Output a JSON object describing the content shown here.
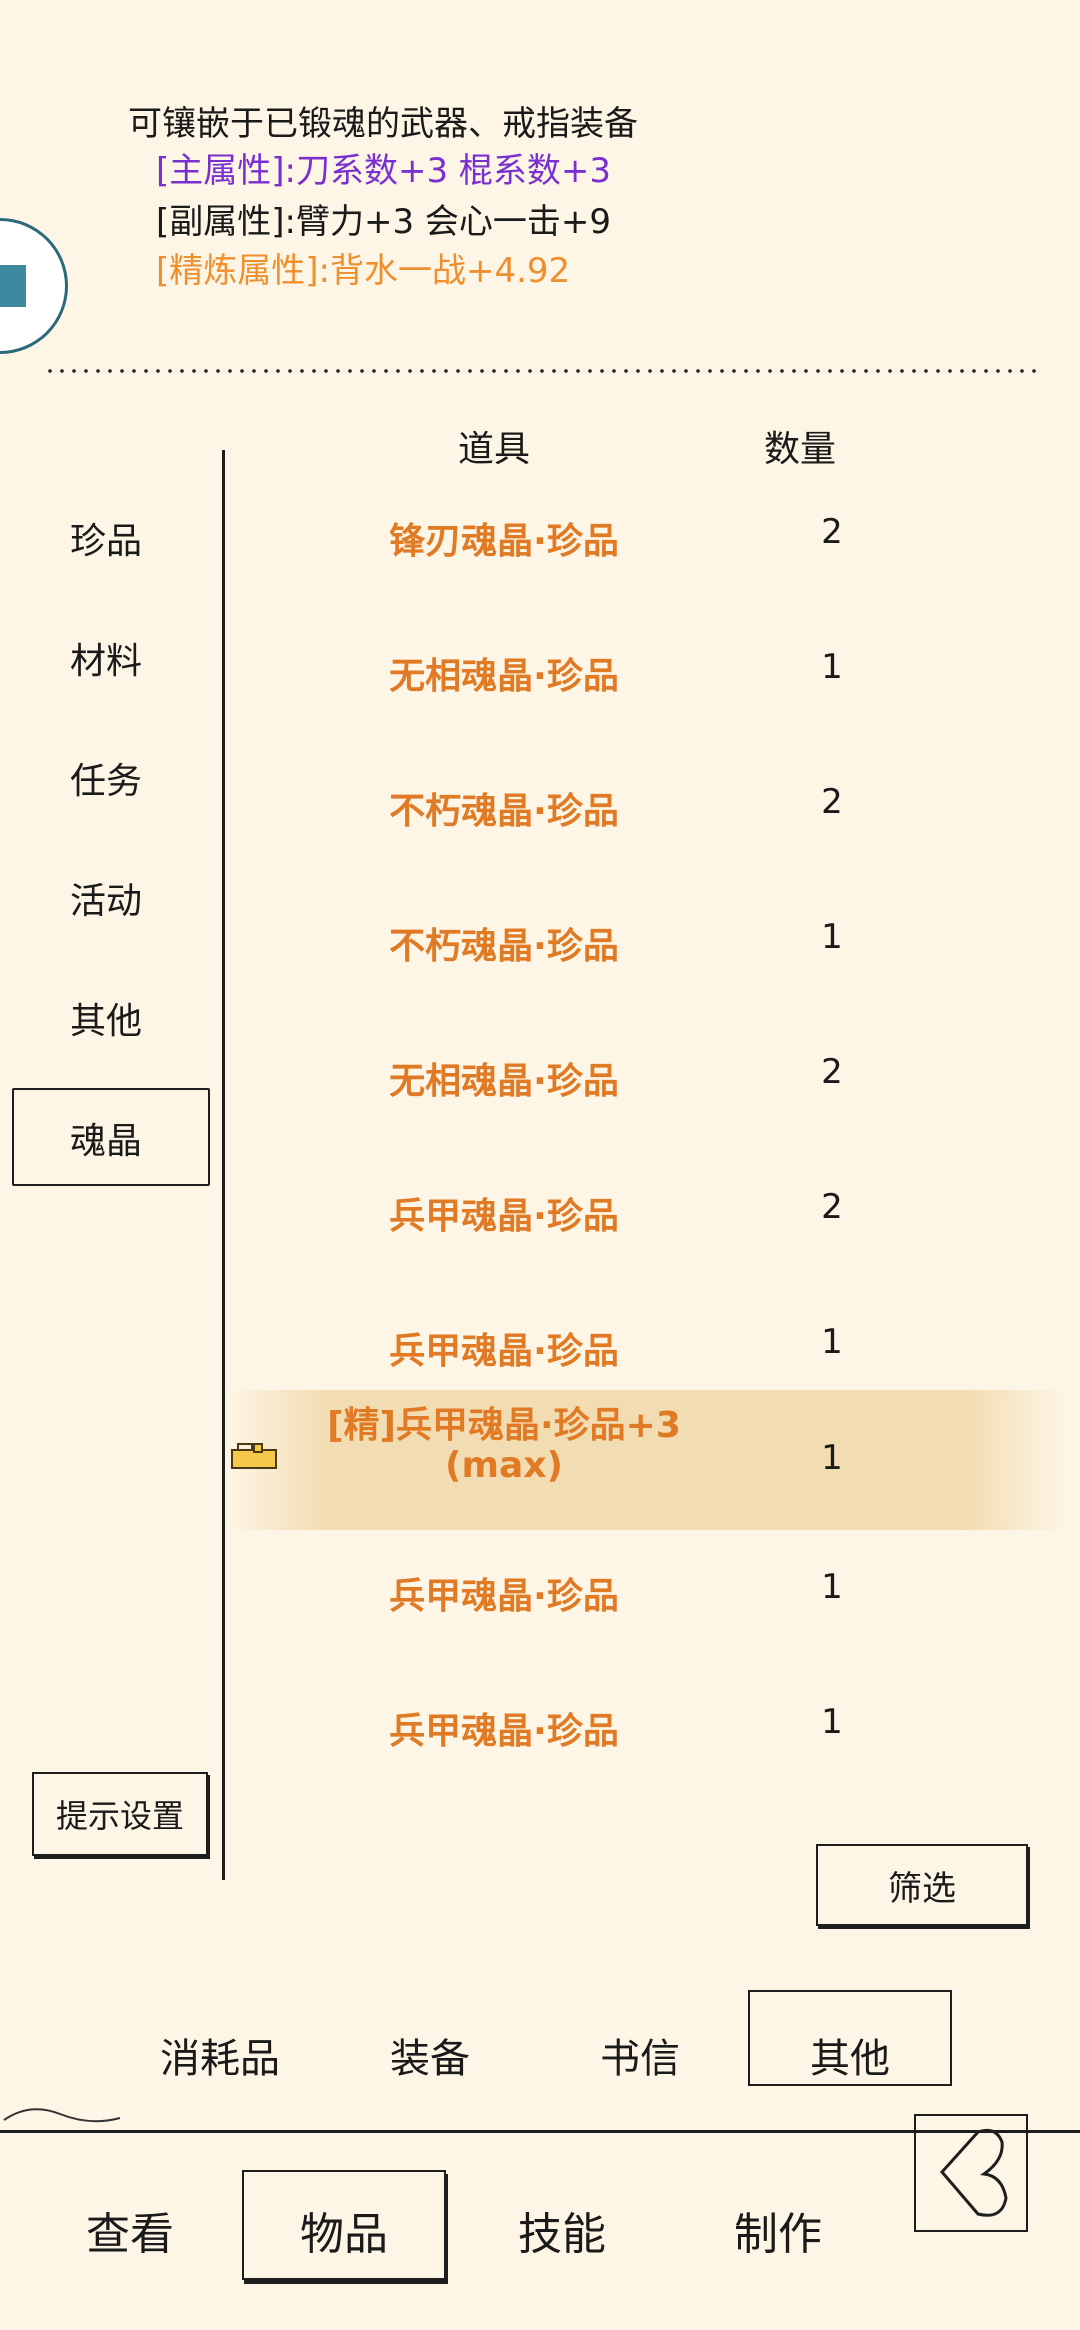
{
  "item_detail": {
    "description": "可镶嵌于已锻魂的武器、戒指装备",
    "main_attr": "[主属性]:刀系数+3 棍系数+3",
    "sub_attr": "[副属性]:臂力+3 会心一击+9",
    "refine_attr": "[精炼属性]:背水一战+4.92"
  },
  "sidebar": {
    "categories": [
      "珍品",
      "材料",
      "任务",
      "活动",
      "其他",
      "魂晶"
    ],
    "selected": "魂晶",
    "hint_button": "提示设置"
  },
  "table": {
    "headers": [
      "道具",
      "数量"
    ],
    "rows": [
      {
        "name": "锋刃魂晶·珍品",
        "qty": "2"
      },
      {
        "name": "无相魂晶·珍品",
        "qty": "1"
      },
      {
        "name": "不朽魂晶·珍品",
        "qty": "2"
      },
      {
        "name": "不朽魂晶·珍品",
        "qty": "1"
      },
      {
        "name": "无相魂晶·珍品",
        "qty": "2"
      },
      {
        "name": "兵甲魂晶·珍品",
        "qty": "2"
      },
      {
        "name": "兵甲魂晶·珍品",
        "qty": "1"
      },
      {
        "name": "[精]兵甲魂晶·珍品+3\n(max)",
        "qty": "1",
        "locked": true,
        "selected": true
      },
      {
        "name": "兵甲魂晶·珍品",
        "qty": "1"
      },
      {
        "name": "兵甲魂晶·珍品",
        "qty": "1"
      }
    ],
    "filter_button": "筛选"
  },
  "type_tabs": [
    "消耗品",
    "装备",
    "书信",
    "其他"
  ],
  "type_tab_selected": "其他",
  "bottom_nav": [
    "查看",
    "物品",
    "技能",
    "制作"
  ],
  "bottom_nav_selected": "物品",
  "colors": {
    "background": "#fdf5e5",
    "item_orange": "#e07a25",
    "main_attr_purple": "#7a2fd0",
    "refine_attr_orange": "#f08f2e"
  }
}
